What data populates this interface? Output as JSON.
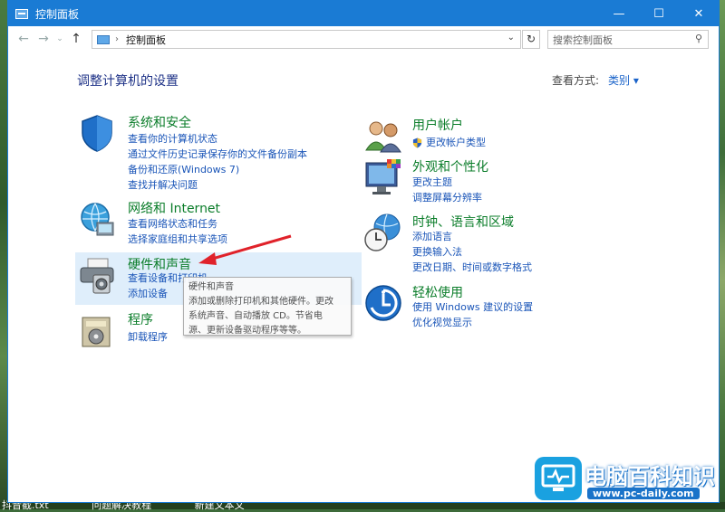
{
  "window": {
    "title": "控制面板"
  },
  "address": {
    "path": "控制面板",
    "sep": "›"
  },
  "search": {
    "placeholder": "搜索控制面板"
  },
  "heading": "调整计算机的设置",
  "view_by": {
    "label": "查看方式:",
    "value": "类别"
  },
  "left_categories": [
    {
      "title": "系统和安全",
      "links": [
        "查看你的计算机状态",
        "通过文件历史记录保存你的文件备份副本",
        "备份和还原(Windows 7)",
        "查找并解决问题"
      ]
    },
    {
      "title": "网络和 Internet",
      "links": [
        "查看网络状态和任务",
        "选择家庭组和共享选项"
      ]
    },
    {
      "title": "硬件和声音",
      "links": [
        "查看设备和打印机",
        "添加设备"
      ]
    },
    {
      "title": "程序",
      "links": [
        "卸载程序"
      ]
    }
  ],
  "right_categories": [
    {
      "title": "用户帐户",
      "links": [
        "更改帐户类型"
      ]
    },
    {
      "title": "外观和个性化",
      "links": [
        "更改主题",
        "调整屏幕分辨率"
      ]
    },
    {
      "title": "时钟、语言和区域",
      "links": [
        "添加语言",
        "更换输入法",
        "更改日期、时间或数字格式"
      ]
    },
    {
      "title": "轻松使用",
      "links": [
        "使用 Windows 建议的设置",
        "优化视觉显示"
      ]
    }
  ],
  "tooltip": {
    "lines": [
      "硬件和声音",
      "添加或删除打印机和其他硬件。更改",
      "系统声音、自动播放 CD。节省电",
      "源、更新设备驱动程序等等。"
    ]
  },
  "taskbar": {
    "items": [
      "抖音截.txt",
      "问题解决教程",
      "新建文本文"
    ]
  },
  "watermark": {
    "title": "电脑百科知识",
    "url": "www.pc-daily.com"
  },
  "colors": {
    "accent": "#1a7bd4",
    "category_title": "#0b7d2a",
    "link": "#1a55b8",
    "heading": "#1e3287",
    "arrow": "#e0222a"
  }
}
